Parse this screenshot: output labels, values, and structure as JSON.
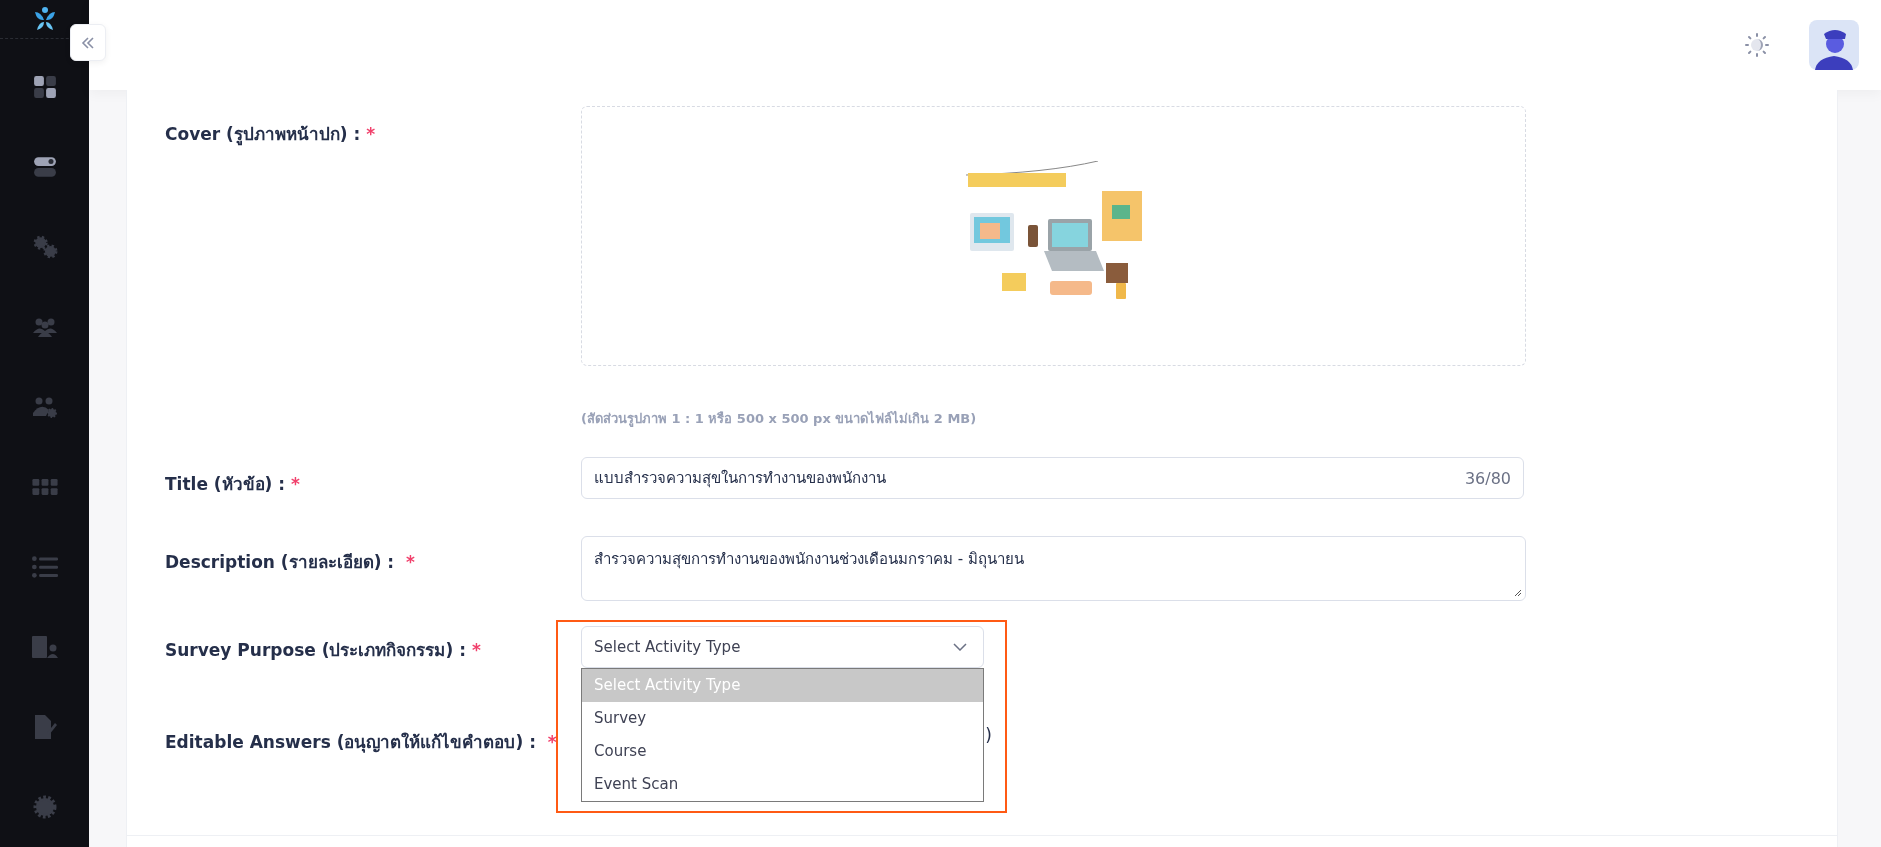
{
  "form": {
    "fields": [
      {
        "kind": "cover",
        "label": "Cover (รูปภาพหน้าปก) :",
        "required_mark": "*",
        "hint": "(สัดส่วนรูปภาพ 1 : 1 หรือ 500 x 500 px ขนาดไฟล์ไม่เกิน 2 MB)"
      },
      {
        "kind": "text",
        "label": "Title (หัวข้อ) :",
        "required_mark": "*",
        "value": "แบบสำรวจความสุขในการทำงานของพนักงาน",
        "counter": "36/80"
      },
      {
        "kind": "textarea",
        "label": "Description (รายละเอียด) :",
        "required_mark": "*",
        "value": "สำรวจความสุขการทำงานของพนักงานช่วงเดือนมกราคม - มิถุนายน"
      },
      {
        "kind": "select",
        "label": "Survey Purpose (ประเภทกิจกรรม) :",
        "required_mark": "*",
        "value": "Select Activity Type",
        "expanded": true,
        "highlighted": true,
        "options": [
          {
            "label": "Select Activity Type",
            "selected": true
          },
          {
            "label": "Survey",
            "selected": false
          },
          {
            "label": "Course",
            "selected": false
          },
          {
            "label": "Event Scan",
            "selected": false
          }
        ]
      },
      {
        "kind": "partial",
        "label": "Editable Answers (อนุญาตให้แก้ไขคำตอบ) :",
        "required_mark": "*",
        "visible_text": ")"
      }
    ]
  }
}
